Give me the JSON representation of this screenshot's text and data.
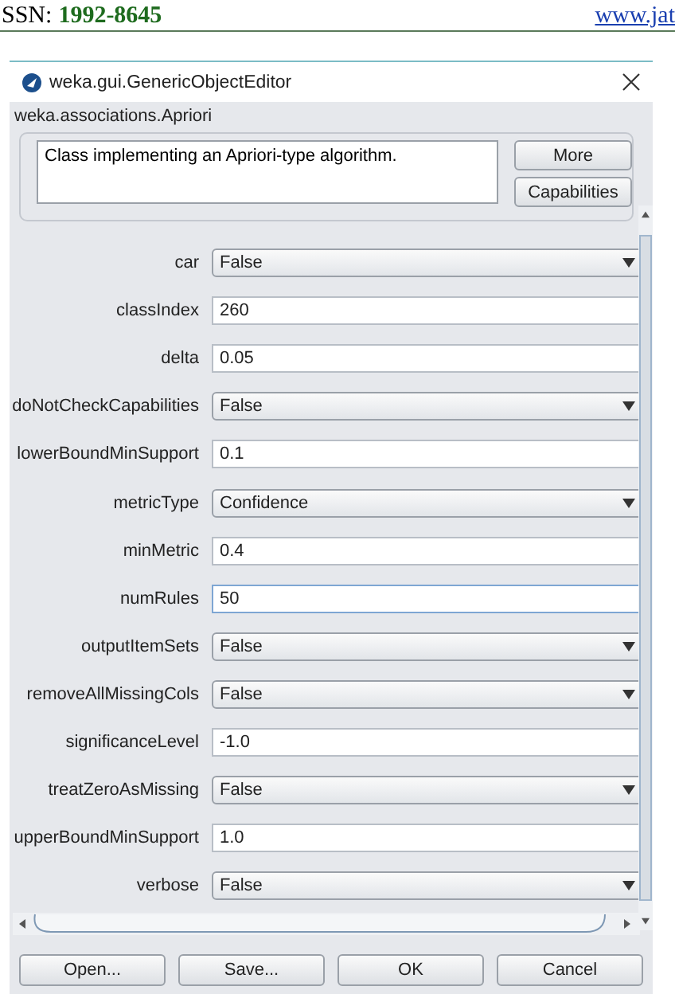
{
  "page_header": {
    "issn_label": "SSN:",
    "issn_number": "1992-8645",
    "website": "www.jat"
  },
  "window": {
    "title": "weka.gui.GenericObjectEditor",
    "class_name": "weka.associations.Apriori"
  },
  "about": {
    "description": "Class implementing an Apriori-type algorithm.",
    "buttons": [
      "More",
      "Capabilities"
    ]
  },
  "properties": [
    {
      "label": "car",
      "kind": "dropdown",
      "value": "False"
    },
    {
      "label": "classIndex",
      "kind": "text",
      "value": "260",
      "focused": false
    },
    {
      "label": "delta",
      "kind": "text",
      "value": "0.05",
      "focused": false
    },
    {
      "label": "doNotCheckCapabilities",
      "kind": "dropdown",
      "value": "False"
    },
    {
      "label": "lowerBoundMinSupport",
      "kind": "text",
      "value": "0.1",
      "focused": false
    },
    {
      "label": "metricType",
      "kind": "dropdown",
      "value": "Confidence"
    },
    {
      "label": "minMetric",
      "kind": "text",
      "value": "0.4",
      "focused": false
    },
    {
      "label": "numRules",
      "kind": "text",
      "value": "50",
      "focused": true
    },
    {
      "label": "outputItemSets",
      "kind": "dropdown",
      "value": "False"
    },
    {
      "label": "removeAllMissingCols",
      "kind": "dropdown",
      "value": "False"
    },
    {
      "label": "significanceLevel",
      "kind": "text",
      "value": "-1.0",
      "focused": false
    },
    {
      "label": "treatZeroAsMissing",
      "kind": "dropdown",
      "value": "False"
    },
    {
      "label": "upperBoundMinSupport",
      "kind": "text",
      "value": "1.0",
      "focused": false
    },
    {
      "label": "verbose",
      "kind": "dropdown",
      "value": "False"
    }
  ],
  "buttons": [
    "Open...",
    "Save...",
    "OK",
    "Cancel"
  ]
}
